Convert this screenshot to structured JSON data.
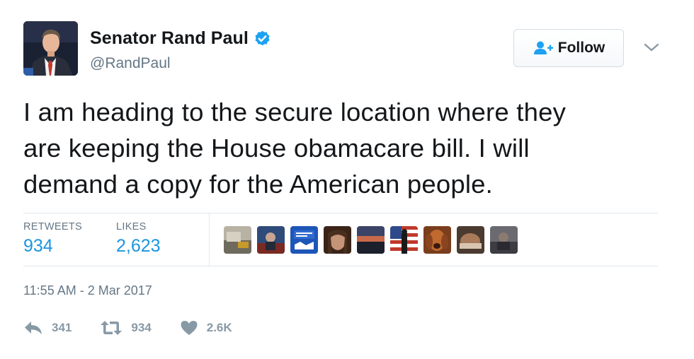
{
  "author": {
    "name": "Senator Rand Paul",
    "handle": "@RandPaul",
    "verified": true
  },
  "follow_button": {
    "label": "Follow"
  },
  "tweet": {
    "lines": [
      "I am heading to the secure location where they",
      "are keeping the House obamacare bill. I will",
      "demand a copy for the American people."
    ]
  },
  "stats": {
    "retweets_label": "RETWEETS",
    "retweets_value": "934",
    "likes_label": "LIKES",
    "likes_value": "2,623"
  },
  "likers": [
    {
      "icon": "liker-avatar-1"
    },
    {
      "icon": "liker-avatar-2"
    },
    {
      "icon": "liker-avatar-3"
    },
    {
      "icon": "liker-avatar-4"
    },
    {
      "icon": "liker-avatar-5"
    },
    {
      "icon": "liker-avatar-6"
    },
    {
      "icon": "liker-avatar-7"
    },
    {
      "icon": "liker-avatar-8"
    },
    {
      "icon": "liker-avatar-9"
    }
  ],
  "timestamp": "11:55 AM - 2 Mar 2017",
  "actions": {
    "reply_count": "341",
    "retweet_count": "934",
    "like_count": "2.6K"
  },
  "colors": {
    "link_blue": "#1b95e0",
    "muted_gray": "#657786",
    "action_gray": "#8899a6",
    "verified_blue": "#1da1f2"
  }
}
